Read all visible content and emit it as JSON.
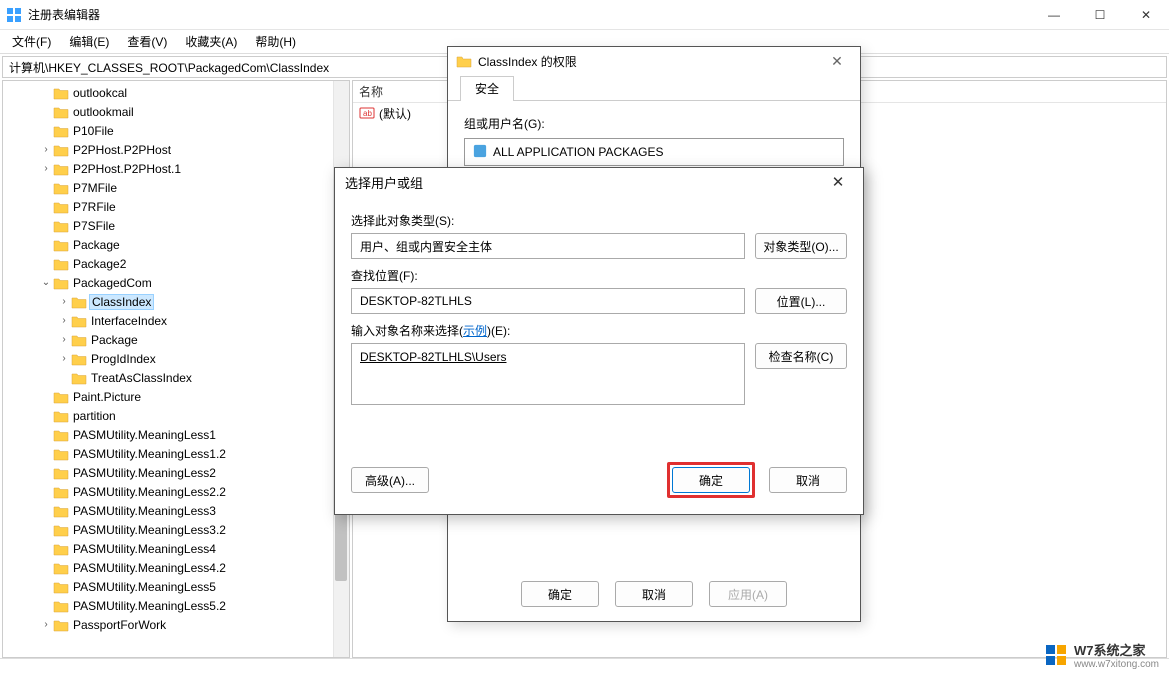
{
  "window": {
    "title": "注册表编辑器",
    "min": "—",
    "max": "☐",
    "close": "✕"
  },
  "menu": {
    "file": "文件(F)",
    "edit": "编辑(E)",
    "view": "查看(V)",
    "fav": "收藏夹(A)",
    "help": "帮助(H)"
  },
  "path": "计算机\\HKEY_CLASSES_ROOT\\PackagedCom\\ClassIndex",
  "tree": [
    {
      "indent": 2,
      "exp": "",
      "label": "outlookcal"
    },
    {
      "indent": 2,
      "exp": "",
      "label": "outlookmail"
    },
    {
      "indent": 2,
      "exp": "",
      "label": "P10File"
    },
    {
      "indent": 2,
      "exp": ">",
      "label": "P2PHost.P2PHost"
    },
    {
      "indent": 2,
      "exp": ">",
      "label": "P2PHost.P2PHost.1"
    },
    {
      "indent": 2,
      "exp": "",
      "label": "P7MFile"
    },
    {
      "indent": 2,
      "exp": "",
      "label": "P7RFile"
    },
    {
      "indent": 2,
      "exp": "",
      "label": "P7SFile"
    },
    {
      "indent": 2,
      "exp": "",
      "label": "Package"
    },
    {
      "indent": 2,
      "exp": "",
      "label": "Package2"
    },
    {
      "indent": 2,
      "exp": "v",
      "label": "PackagedCom"
    },
    {
      "indent": 3,
      "exp": ">",
      "label": "ClassIndex",
      "selected": true
    },
    {
      "indent": 3,
      "exp": ">",
      "label": "InterfaceIndex"
    },
    {
      "indent": 3,
      "exp": ">",
      "label": "Package"
    },
    {
      "indent": 3,
      "exp": ">",
      "label": "ProgIdIndex"
    },
    {
      "indent": 3,
      "exp": "",
      "label": "TreatAsClassIndex"
    },
    {
      "indent": 2,
      "exp": "",
      "label": "Paint.Picture"
    },
    {
      "indent": 2,
      "exp": "",
      "label": "partition"
    },
    {
      "indent": 2,
      "exp": "",
      "label": "PASMUtility.MeaningLess1"
    },
    {
      "indent": 2,
      "exp": "",
      "label": "PASMUtility.MeaningLess1.2"
    },
    {
      "indent": 2,
      "exp": "",
      "label": "PASMUtility.MeaningLess2"
    },
    {
      "indent": 2,
      "exp": "",
      "label": "PASMUtility.MeaningLess2.2"
    },
    {
      "indent": 2,
      "exp": "",
      "label": "PASMUtility.MeaningLess3"
    },
    {
      "indent": 2,
      "exp": "",
      "label": "PASMUtility.MeaningLess3.2"
    },
    {
      "indent": 2,
      "exp": "",
      "label": "PASMUtility.MeaningLess4"
    },
    {
      "indent": 2,
      "exp": "",
      "label": "PASMUtility.MeaningLess4.2"
    },
    {
      "indent": 2,
      "exp": "",
      "label": "PASMUtility.MeaningLess5"
    },
    {
      "indent": 2,
      "exp": "",
      "label": "PASMUtility.MeaningLess5.2"
    },
    {
      "indent": 2,
      "exp": ">",
      "label": "PassportForWork"
    }
  ],
  "list": {
    "col_name": "名称",
    "def_value": "(默认)"
  },
  "perm_dialog": {
    "title": "ClassIndex 的权限",
    "tab": "安全",
    "group_label": "组或用户名(G):",
    "group_item": "ALL APPLICATION PACKAGES",
    "ok": "确定",
    "cancel": "取消",
    "apply": "应用(A)"
  },
  "sel_dialog": {
    "title": "选择用户或组",
    "obj_type_label": "选择此对象类型(S):",
    "obj_type_value": "用户、组或内置安全主体",
    "obj_type_btn": "对象类型(O)...",
    "loc_label": "查找位置(F):",
    "loc_value": "DESKTOP-82TLHLS",
    "loc_btn": "位置(L)...",
    "name_label_pre": "输入对象名称来选择(",
    "name_label_link": "示例",
    "name_label_post": ")(E):",
    "name_value": "DESKTOP-82TLHLS\\Users",
    "check_btn": "检查名称(C)",
    "adv_btn": "高级(A)...",
    "ok": "确定",
    "cancel": "取消"
  },
  "watermark": {
    "brand": "W7系统之家",
    "url": "www.w7xitong.com"
  }
}
